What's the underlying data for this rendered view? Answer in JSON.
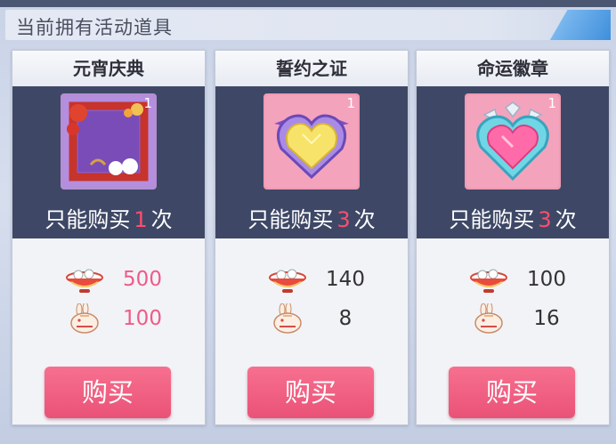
{
  "header": {
    "title": "当前拥有活动道具"
  },
  "cards": [
    {
      "name": "元宵庆典",
      "count": "1",
      "limit_prefix": "只能购买",
      "limit_num": "1",
      "limit_suffix": "次",
      "cost1": "500",
      "cost1_red": true,
      "cost2": "100",
      "cost2_red": true,
      "buy": "购买"
    },
    {
      "name": "誓约之证",
      "count": "1",
      "limit_prefix": "只能购买",
      "limit_num": "3",
      "limit_suffix": "次",
      "cost1": "140",
      "cost1_red": false,
      "cost2": "8",
      "cost2_red": false,
      "buy": "购买"
    },
    {
      "name": "命运徽章",
      "count": "1",
      "limit_prefix": "只能购买",
      "limit_num": "3",
      "limit_suffix": "次",
      "cost1": "100",
      "cost1_red": false,
      "cost2": "16",
      "cost2_red": false,
      "buy": "购买"
    }
  ],
  "icons": {
    "currency1": "tangyuan-bowl-icon",
    "currency2": "rabbit-lantern-icon"
  },
  "colors": {
    "accent_pink": "#ef5b86",
    "band": "#3e4866",
    "button": "#f2607f"
  }
}
